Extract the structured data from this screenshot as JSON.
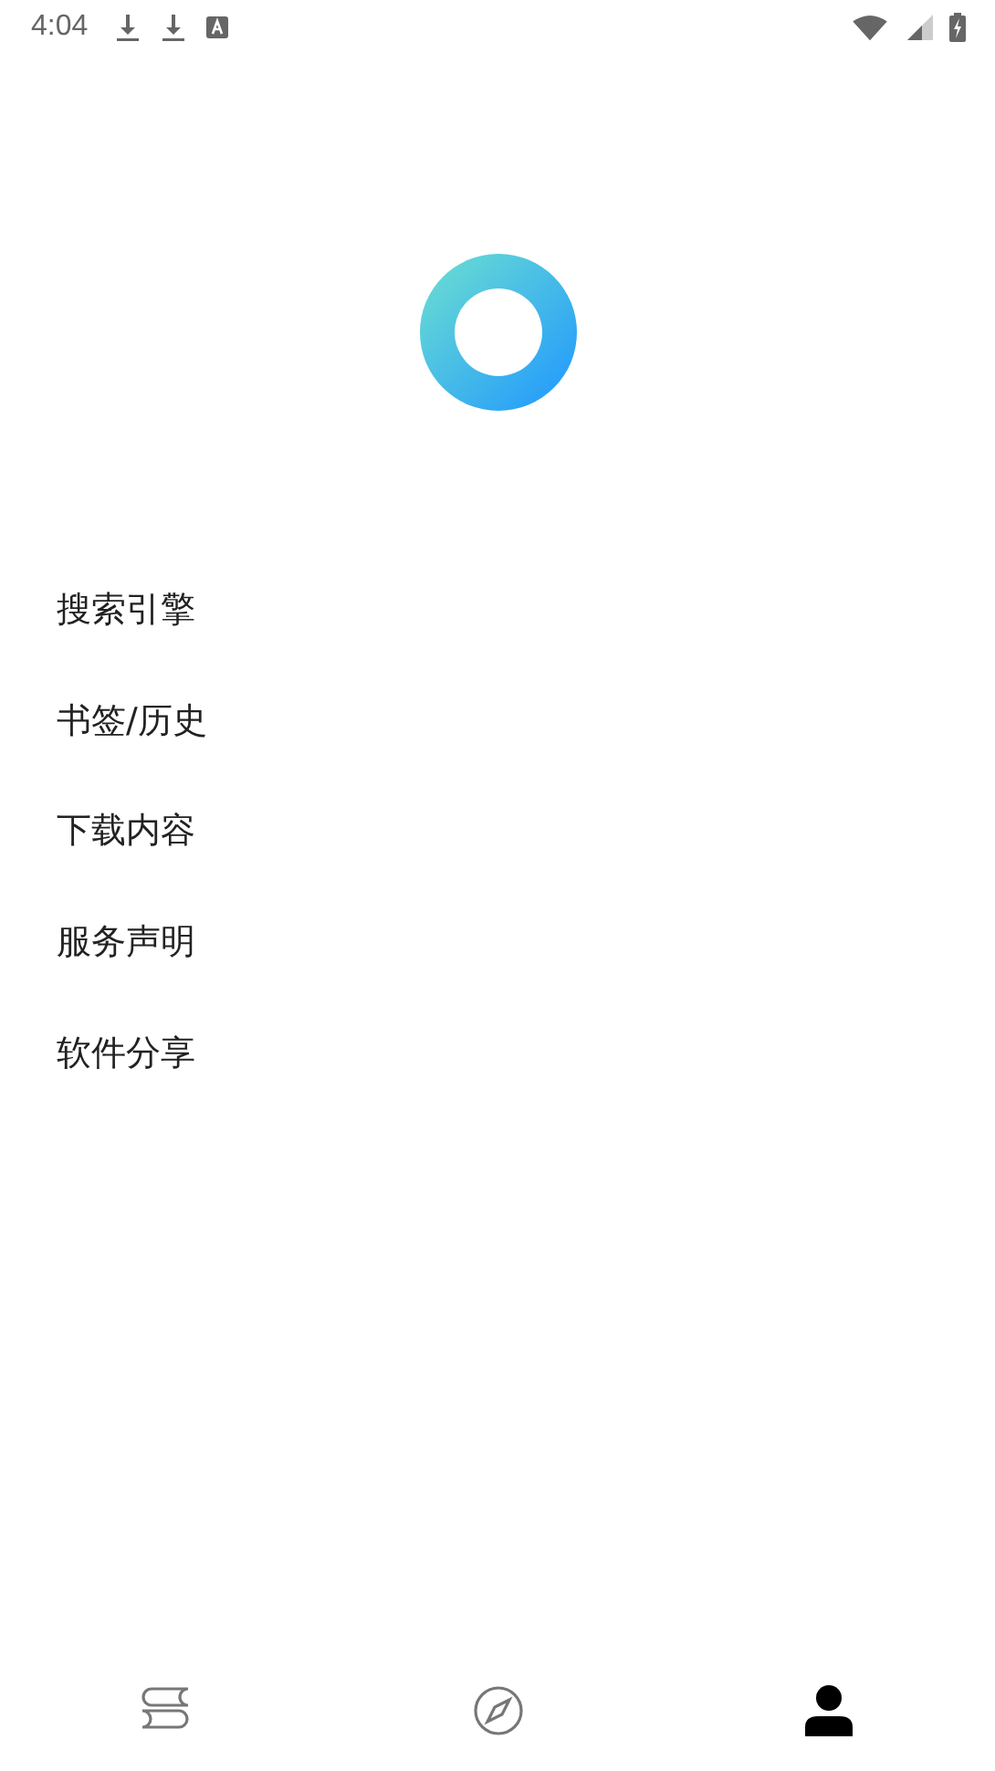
{
  "status_bar": {
    "time": "4:04"
  },
  "menu": [
    {
      "label": "搜索引擎"
    },
    {
      "label": "书签/历史"
    },
    {
      "label": "下载内容"
    },
    {
      "label": "服务声明"
    },
    {
      "label": "软件分享"
    }
  ],
  "bottom_nav": [
    {
      "kind": "books",
      "selected": false
    },
    {
      "kind": "compass",
      "selected": false
    },
    {
      "kind": "person",
      "selected": true
    }
  ]
}
